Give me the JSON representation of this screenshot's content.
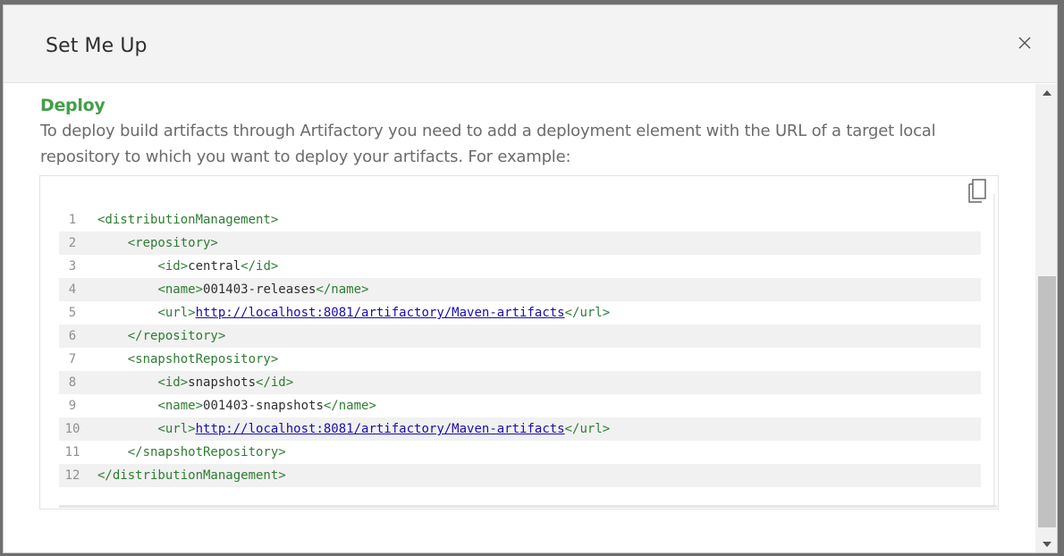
{
  "modal": {
    "title": "Set Me Up"
  },
  "section": {
    "title": "Deploy",
    "description": "To deploy build artifacts through Artifactory you need to add a deployment element with the URL of a target local repository to which you want to deploy your artifacts. For example:"
  },
  "code": {
    "lines": [
      {
        "n": "1",
        "indent": "",
        "parts": [
          {
            "t": "tag",
            "v": "<distributionManagement>"
          }
        ]
      },
      {
        "n": "2",
        "indent": "    ",
        "parts": [
          {
            "t": "tag",
            "v": "<repository>"
          }
        ]
      },
      {
        "n": "3",
        "indent": "        ",
        "parts": [
          {
            "t": "tag",
            "v": "<id>"
          },
          {
            "t": "text",
            "v": "central"
          },
          {
            "t": "tag",
            "v": "</id>"
          }
        ]
      },
      {
        "n": "4",
        "indent": "        ",
        "parts": [
          {
            "t": "tag",
            "v": "<name>"
          },
          {
            "t": "text",
            "v": "001403-releases"
          },
          {
            "t": "tag",
            "v": "</name>"
          }
        ]
      },
      {
        "n": "5",
        "indent": "        ",
        "parts": [
          {
            "t": "tag",
            "v": "<url>"
          },
          {
            "t": "url",
            "v": "http://localhost:8081/artifactory/Maven-artifacts"
          },
          {
            "t": "tag",
            "v": "</url>"
          }
        ]
      },
      {
        "n": "6",
        "indent": "    ",
        "parts": [
          {
            "t": "tag",
            "v": "</repository>"
          }
        ]
      },
      {
        "n": "7",
        "indent": "    ",
        "parts": [
          {
            "t": "tag",
            "v": "<snapshotRepository>"
          }
        ]
      },
      {
        "n": "8",
        "indent": "        ",
        "parts": [
          {
            "t": "tag",
            "v": "<id>"
          },
          {
            "t": "text",
            "v": "snapshots"
          },
          {
            "t": "tag",
            "v": "</id>"
          }
        ]
      },
      {
        "n": "9",
        "indent": "        ",
        "parts": [
          {
            "t": "tag",
            "v": "<name>"
          },
          {
            "t": "text",
            "v": "001403-snapshots"
          },
          {
            "t": "tag",
            "v": "</name>"
          }
        ]
      },
      {
        "n": "10",
        "indent": "        ",
        "parts": [
          {
            "t": "tag",
            "v": "<url>"
          },
          {
            "t": "url",
            "v": "http://localhost:8081/artifactory/Maven-artifacts"
          },
          {
            "t": "tag",
            "v": "</url>"
          }
        ]
      },
      {
        "n": "11",
        "indent": "    ",
        "parts": [
          {
            "t": "tag",
            "v": "</snapshotRepository>"
          }
        ]
      },
      {
        "n": "12",
        "indent": "",
        "parts": [
          {
            "t": "tag",
            "v": "</distributionManagement>"
          }
        ]
      }
    ]
  },
  "icons": {
    "close": "close-icon",
    "copy": "copy-icon",
    "scroll_up": "chevron-up-icon",
    "scroll_down": "chevron-down-icon"
  },
  "colors": {
    "section_title": "#43a047",
    "xml_tag": "#2e7d32",
    "link": "#1a0dab"
  },
  "scrollbar": {
    "position_fraction": 0.55
  }
}
